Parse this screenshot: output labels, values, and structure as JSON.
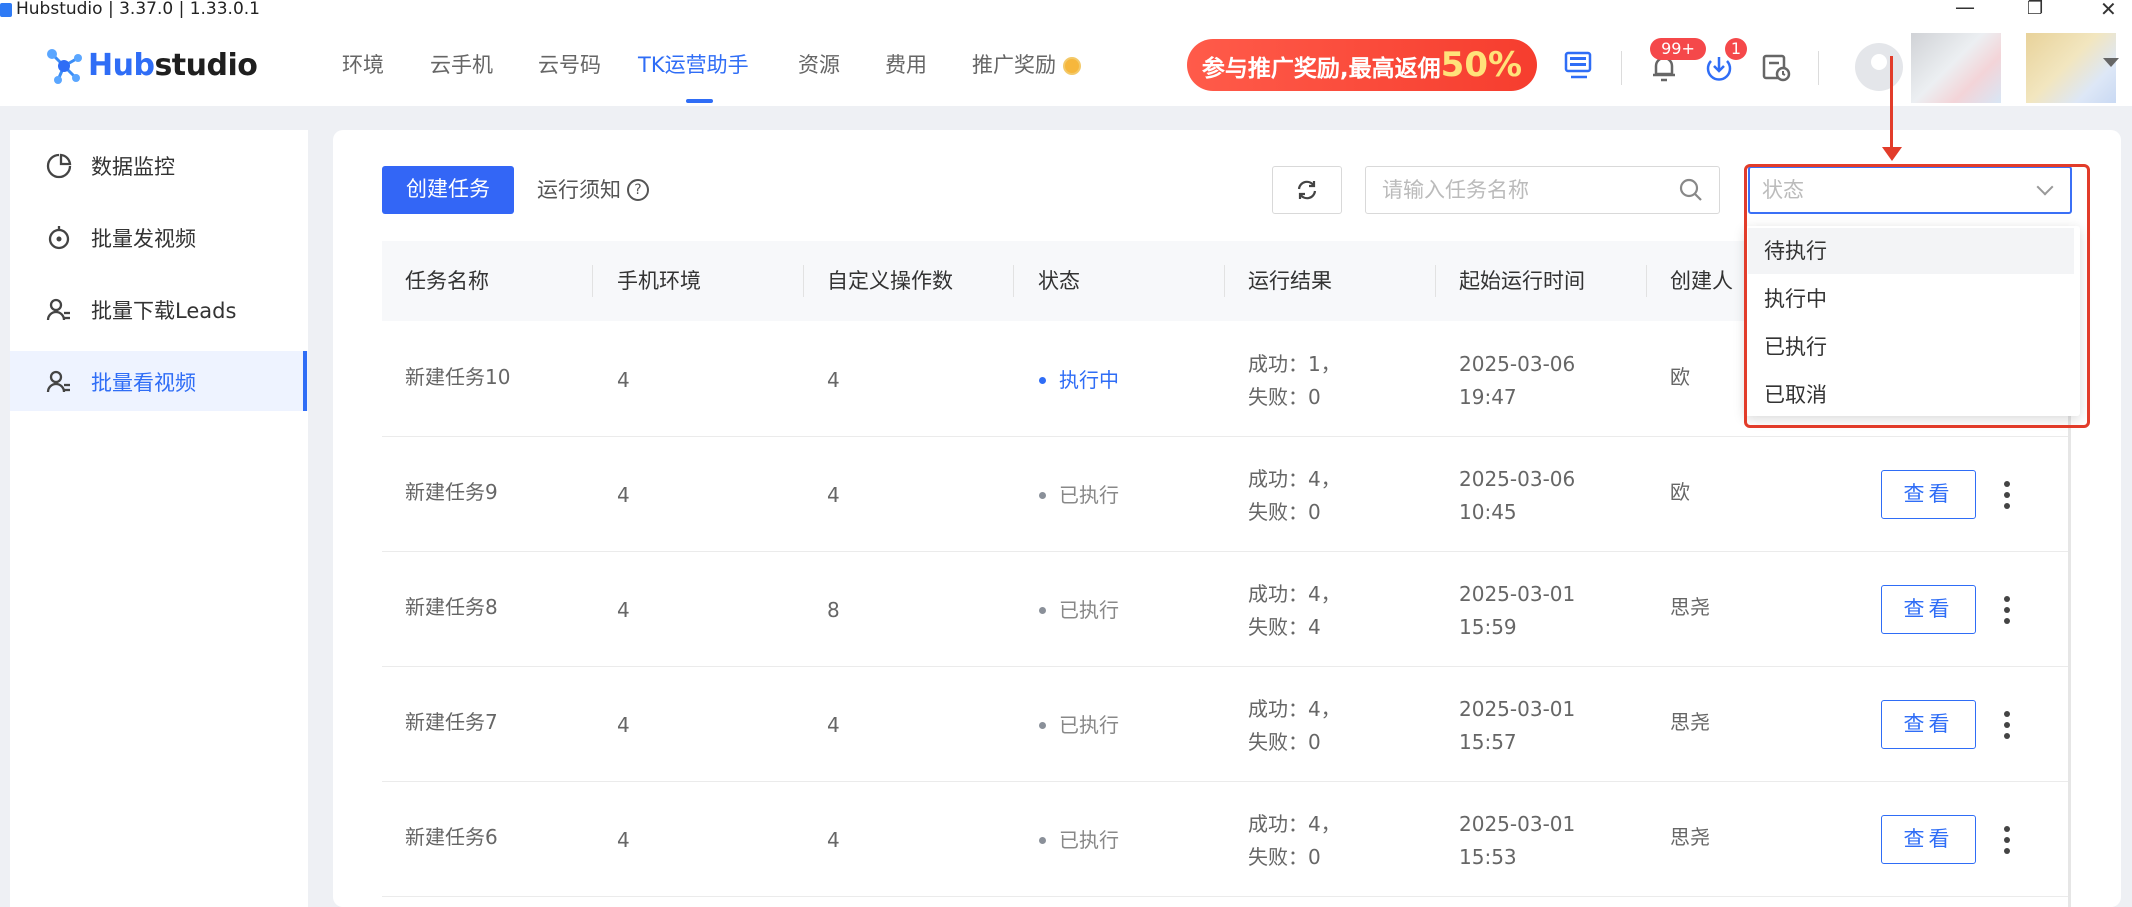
{
  "window": {
    "title": "Hubstudio | 3.37.0 | 1.33.0.1",
    "controls": [
      "—",
      "❐",
      "✕"
    ]
  },
  "header": {
    "logo_prefix": "Hub",
    "logo_suffix": "studio",
    "nav": [
      "环境",
      "云手机",
      "云号码",
      "TK运营助手",
      "资源",
      "费用",
      "推广奖励"
    ],
    "active_nav": "TK运营助手",
    "promo_text": "参与推广奖励,最高返佣",
    "promo_percent": "50%",
    "notification_badge": "99+",
    "download_badge": "1"
  },
  "sidebar": {
    "items": [
      {
        "label": "数据监控",
        "icon": "chart-icon"
      },
      {
        "label": "批量发视频",
        "icon": "robot-icon"
      },
      {
        "label": "批量下载Leads",
        "icon": "users-icon"
      },
      {
        "label": "批量看视频",
        "icon": "users-icon"
      }
    ],
    "active_index": 3
  },
  "toolbar": {
    "create_label": "创建任务",
    "notice_label": "运行须知",
    "search_placeholder": "请输入任务名称",
    "status_placeholder": "状态"
  },
  "table": {
    "columns": [
      "任务名称",
      "手机环境",
      "自定义操作数",
      "状态",
      "运行结果",
      "起始运行时间",
      "创建人"
    ],
    "action_label": "查看",
    "rows": [
      {
        "name": "新建任务10",
        "env": "4",
        "ops": "4",
        "status": "执行中",
        "status_type": "running",
        "result1": "成功：1，",
        "result2": "失败：0",
        "date": "2025-03-06",
        "time": "19:47",
        "creator": "欧"
      },
      {
        "name": "新建任务9",
        "env": "4",
        "ops": "4",
        "status": "已执行",
        "status_type": "done",
        "result1": "成功：4，",
        "result2": "失败：0",
        "date": "2025-03-06",
        "time": "10:45",
        "creator": "欧"
      },
      {
        "name": "新建任务8",
        "env": "4",
        "ops": "8",
        "status": "已执行",
        "status_type": "done",
        "result1": "成功：4，",
        "result2": "失败：4",
        "date": "2025-03-01",
        "time": "15:59",
        "creator": "思尧"
      },
      {
        "name": "新建任务7",
        "env": "4",
        "ops": "4",
        "status": "已执行",
        "status_type": "done",
        "result1": "成功：4，",
        "result2": "失败：0",
        "date": "2025-03-01",
        "time": "15:57",
        "creator": "思尧"
      },
      {
        "name": "新建任务6",
        "env": "4",
        "ops": "4",
        "status": "已执行",
        "status_type": "done",
        "result1": "成功：4，",
        "result2": "失败：0",
        "date": "2025-03-01",
        "time": "15:53",
        "creator": "思尧"
      }
    ]
  },
  "status_dropdown": {
    "options": [
      "待执行",
      "执行中",
      "已执行",
      "已取消"
    ],
    "hover_index": 0
  },
  "colors": {
    "accent": "#2f6df6",
    "annotation": "#e23c2a",
    "running_dot": "#2f6df6",
    "done_dot": "#8a9099"
  }
}
